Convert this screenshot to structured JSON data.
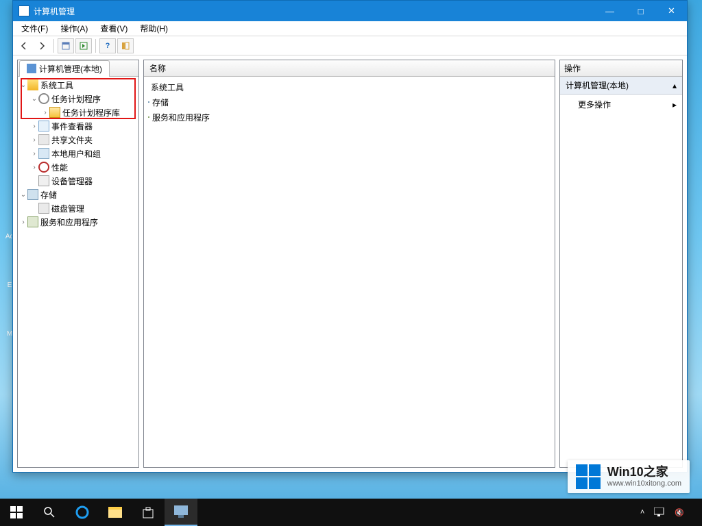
{
  "window": {
    "title": "计算机管理",
    "controls": {
      "minimize": "—",
      "maximize": "□",
      "close": "✕"
    }
  },
  "menubar": [
    "文件(F)",
    "操作(A)",
    "查看(V)",
    "帮助(H)"
  ],
  "tree_root_tab": "计算机管理(本地)",
  "tree": {
    "systools": "系统工具",
    "tasksched": "任务计划程序",
    "taskschedlib": "任务计划程序库",
    "eventviewer": "事件查看器",
    "shared": "共享文件夹",
    "localusers": "本地用户和组",
    "perf": "性能",
    "device": "设备管理器",
    "storage": "存储",
    "diskmgmt": "磁盘管理",
    "services": "服务和应用程序"
  },
  "mid": {
    "header": "名称",
    "items": [
      "系统工具",
      "存储",
      "服务和应用程序"
    ]
  },
  "right": {
    "header": "操作",
    "section": "计算机管理(本地)",
    "more": "更多操作"
  },
  "watermark": {
    "brand": "Win10之家",
    "url": "www.win10xitong.com"
  }
}
